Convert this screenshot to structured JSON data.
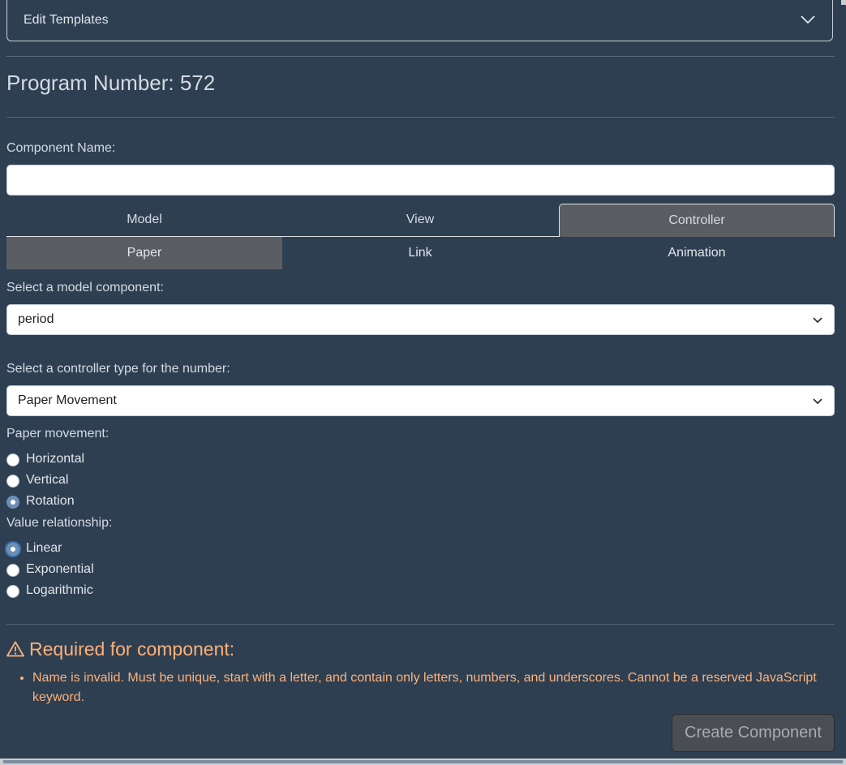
{
  "accordion": {
    "label": "Edit Templates"
  },
  "program": {
    "title": "Program Number: 572"
  },
  "component_name": {
    "label": "Component Name:",
    "value": "",
    "placeholder": ""
  },
  "tabs_top": [
    {
      "label": "Model",
      "active": false
    },
    {
      "label": "View",
      "active": false
    },
    {
      "label": "Controller",
      "active": true
    }
  ],
  "tabs_sub": [
    {
      "label": "Paper",
      "active": true
    },
    {
      "label": "Link",
      "active": false
    },
    {
      "label": "Animation",
      "active": false
    }
  ],
  "model_select": {
    "label": "Select a model component:",
    "value": "period"
  },
  "controller_select": {
    "label": "Select a controller type for the number:",
    "value": "Paper Movement"
  },
  "paper_movement": {
    "label": "Paper movement:",
    "options": [
      {
        "label": "Horizontal",
        "checked": false
      },
      {
        "label": "Vertical",
        "checked": false
      },
      {
        "label": "Rotation",
        "checked": true
      }
    ]
  },
  "value_relationship": {
    "label": "Value relationship:",
    "options": [
      {
        "label": "Linear",
        "checked": true
      },
      {
        "label": "Exponential",
        "checked": false
      },
      {
        "label": "Logarithmic",
        "checked": false
      }
    ]
  },
  "warning": {
    "title": "Required for component:",
    "items": [
      "Name is invalid. Must be unique, start with a letter, and contain only letters, numbers, and underscores. Cannot be a reserved JavaScript keyword."
    ],
    "color": "#ffb179"
  },
  "create_button": {
    "label": "Create Component"
  },
  "colors": {
    "background": "#2e3f52",
    "active_tab": "#5a5e62",
    "accent": "#6e8fb5"
  }
}
